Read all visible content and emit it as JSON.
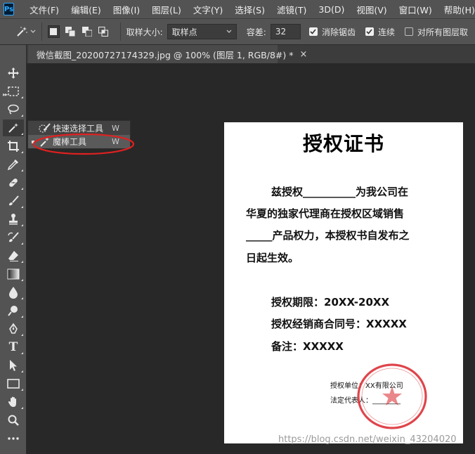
{
  "app": {
    "logo": "Ps"
  },
  "menu": [
    "文件(F)",
    "编辑(E)",
    "图像(I)",
    "图层(L)",
    "文字(Y)",
    "选择(S)",
    "滤镜(T)",
    "3D(D)",
    "视图(V)",
    "窗口(W)",
    "帮助(H)"
  ],
  "options": {
    "sample_size_label": "取样大小:",
    "sample_size_value": "取样点",
    "tolerance_label": "容差:",
    "tolerance_value": "32",
    "antialias_label": "消除锯齿",
    "antialias_checked": true,
    "contiguous_label": "连续",
    "contiguous_checked": true,
    "all_layers_label": "对所有图层取",
    "all_layers_checked": false
  },
  "document_tab": {
    "title": "微信截图_20200727174329.jpg @ 100% (图层 1, RGB/8#) *",
    "close": "×"
  },
  "tool_flyout": {
    "items": [
      {
        "label": "快速选择工具",
        "shortcut": "W",
        "icon": "quick-selection-icon",
        "selected": false
      },
      {
        "label": "魔棒工具",
        "shortcut": "W",
        "icon": "magic-wand-icon",
        "selected": true
      }
    ]
  },
  "toolbar": {
    "tools": [
      "move-icon",
      "marquee-icon",
      "lasso-icon",
      "magic-wand-icon",
      "crop-icon",
      "eyedropper-icon",
      "healing-brush-icon",
      "brush-icon",
      "clone-stamp-icon",
      "history-brush-icon",
      "eraser-icon",
      "gradient-icon",
      "blur-icon",
      "dodge-icon",
      "pen-icon",
      "type-icon",
      "path-selection-icon",
      "rectangle-icon",
      "hand-icon",
      "zoom-icon",
      "more-tools-icon"
    ],
    "type_glyph": "T"
  },
  "certificate": {
    "title": "授权证书",
    "body_lines": [
      "兹授权__________为我公司在",
      "华夏的独家代理商在授权区域销售",
      "_____产品权力，本授权书自发布之",
      "日起生效。"
    ],
    "term": "授权期限：20XX-20XX",
    "contract_no": "授权经销商合同号：XXXXX",
    "remark": "备注：XXXXX",
    "unit": "授权单位：XX有限公司",
    "legal_rep": "法定代表人：________"
  },
  "watermark": "https://blog.csdn.net/weixin_43204020",
  "colors": {
    "accent": "#31a8ff",
    "annotation_red": "#e02020",
    "seal_red": "#d9252b"
  }
}
